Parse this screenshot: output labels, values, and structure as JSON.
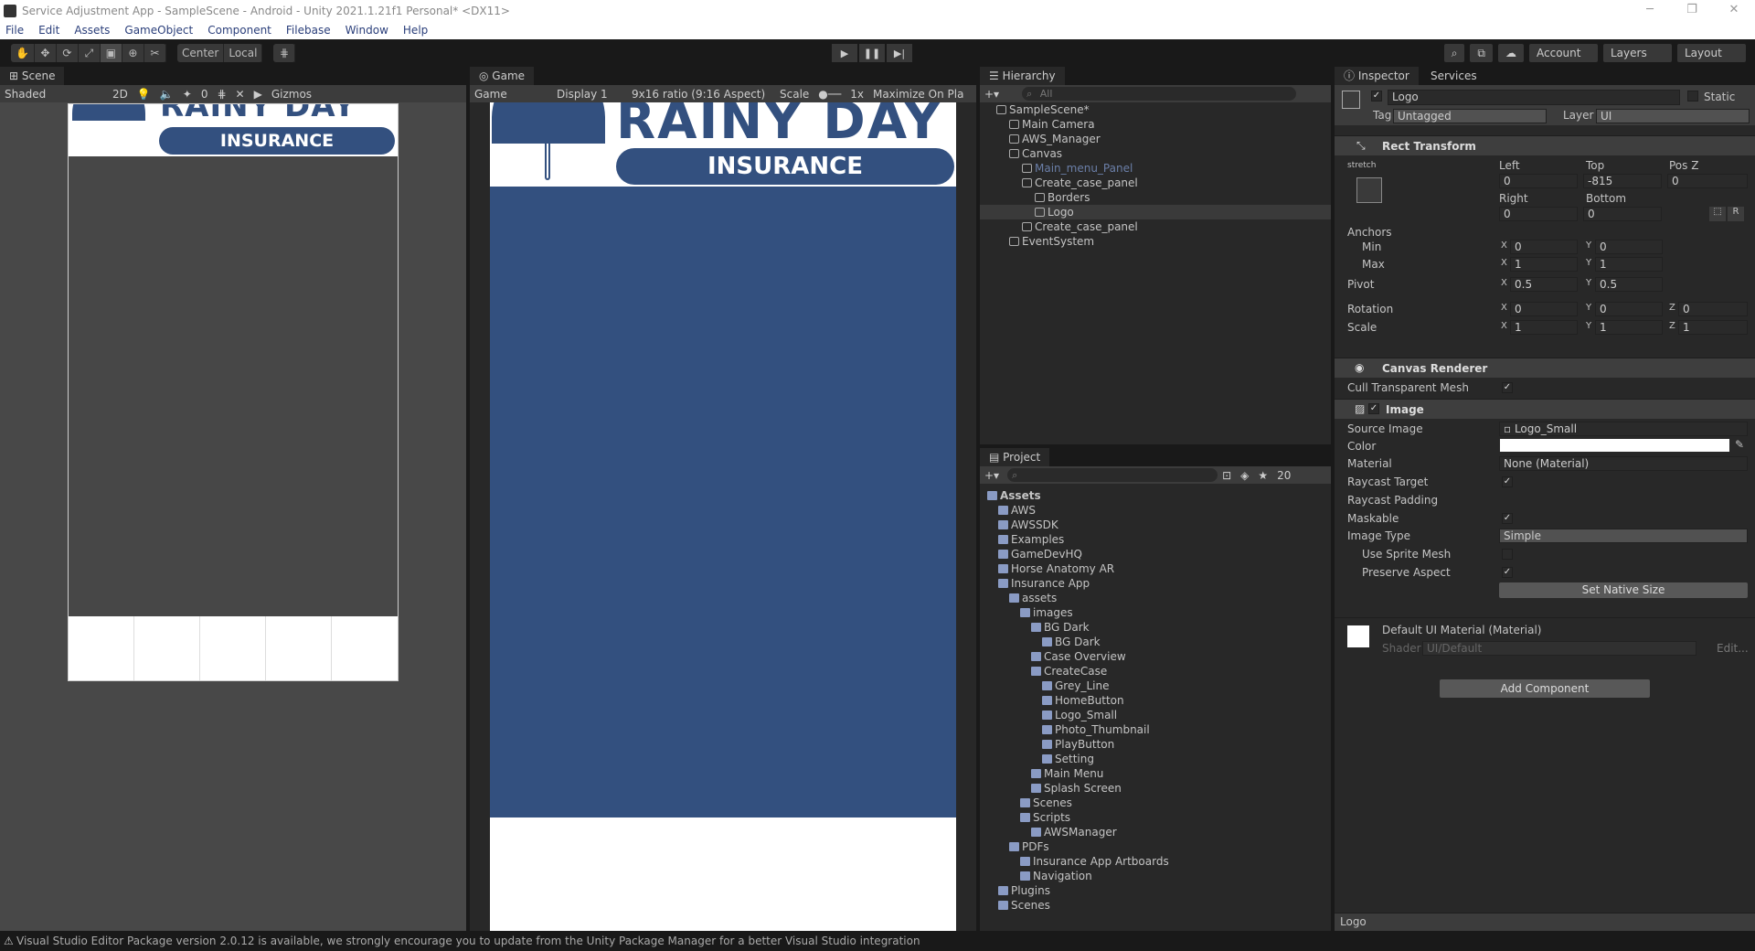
{
  "window": {
    "title": "Service Adjustment App - SampleScene - Android - Unity 2021.1.21f1 Personal* <DX11>",
    "min": "─",
    "max": "❐",
    "close": "✕"
  },
  "menu": [
    "File",
    "Edit",
    "Assets",
    "GameObject",
    "Component",
    "Filebase",
    "Window",
    "Help"
  ],
  "toolbar": {
    "center": "Center",
    "local": "Local",
    "account": "Account",
    "layers": "Layers",
    "layout": "Layout"
  },
  "scene": {
    "tab": "Scene",
    "shading": "Shaded",
    "mode2d": "2D",
    "gizmos": "Gizmos",
    "count": "0",
    "banner_top": "RAINY DAY",
    "banner_sub": "INSURANCE"
  },
  "game": {
    "tab": "Game",
    "display": "Game",
    "display_num": "Display 1",
    "ratio": "9x16 ratio (9:16 Aspect)",
    "scale_label": "Scale",
    "scale_value": "1x",
    "maximize": "Maximize On Pla",
    "banner_top": "RAINY DAY",
    "banner_sub": "INSURANCE"
  },
  "hierarchy": {
    "tab": "Hierarchy",
    "search_placeholder": "All",
    "items": [
      {
        "label": "SampleScene*",
        "indent": 0,
        "kind": "scene"
      },
      {
        "label": "Main Camera",
        "indent": 1,
        "kind": "go"
      },
      {
        "label": "AWS_Manager",
        "indent": 1,
        "kind": "go"
      },
      {
        "label": "Canvas",
        "indent": 1,
        "kind": "go"
      },
      {
        "label": "Main_menu_Panel",
        "indent": 2,
        "kind": "dim"
      },
      {
        "label": "Create_case_panel",
        "indent": 2,
        "kind": "go"
      },
      {
        "label": "Borders",
        "indent": 3,
        "kind": "go"
      },
      {
        "label": "Logo",
        "indent": 3,
        "kind": "sel"
      },
      {
        "label": "Create_case_panel",
        "indent": 2,
        "kind": "go"
      },
      {
        "label": "EventSystem",
        "indent": 1,
        "kind": "go"
      }
    ]
  },
  "project": {
    "tab": "Project",
    "hidden_count": "20",
    "items": [
      {
        "label": "Assets",
        "indent": 0,
        "bold": true
      },
      {
        "label": "AWS",
        "indent": 1
      },
      {
        "label": "AWSSDK",
        "indent": 1
      },
      {
        "label": "Examples",
        "indent": 1
      },
      {
        "label": "GameDevHQ",
        "indent": 1
      },
      {
        "label": "Horse Anatomy AR",
        "indent": 1
      },
      {
        "label": "Insurance App",
        "indent": 1
      },
      {
        "label": "assets",
        "indent": 2
      },
      {
        "label": "images",
        "indent": 3
      },
      {
        "label": "BG Dark",
        "indent": 4
      },
      {
        "label": "BG Dark",
        "indent": 5
      },
      {
        "label": "Case Overview",
        "indent": 4
      },
      {
        "label": "CreateCase",
        "indent": 4
      },
      {
        "label": "Grey_Line",
        "indent": 5
      },
      {
        "label": "HomeButton",
        "indent": 5
      },
      {
        "label": "Logo_Small",
        "indent": 5
      },
      {
        "label": "Photo_Thumbnail",
        "indent": 5
      },
      {
        "label": "PlayButton",
        "indent": 5
      },
      {
        "label": "Setting",
        "indent": 5
      },
      {
        "label": "Main Menu",
        "indent": 4
      },
      {
        "label": "Splash Screen",
        "indent": 4
      },
      {
        "label": "Scenes",
        "indent": 3
      },
      {
        "label": "Scripts",
        "indent": 3
      },
      {
        "label": "AWSManager",
        "indent": 4
      },
      {
        "label": "PDFs",
        "indent": 2
      },
      {
        "label": "Insurance App Artboards",
        "indent": 3
      },
      {
        "label": "Navigation",
        "indent": 3
      },
      {
        "label": "Plugins",
        "indent": 1
      },
      {
        "label": "Scenes",
        "indent": 1
      }
    ]
  },
  "inspector": {
    "tab": "Inspector",
    "tab2": "Services",
    "name": "Logo",
    "static": "Static",
    "tag_label": "Tag",
    "tag": "Untagged",
    "layer_label": "Layer",
    "layer": "UI",
    "rect": {
      "title": "Rect Transform",
      "stretch": "stretch",
      "left_lbl": "Left",
      "top_lbl": "Top",
      "posz_lbl": "Pos Z",
      "left": "0",
      "top": "-815",
      "posz": "0",
      "right_lbl": "Right",
      "bottom_lbl": "Bottom",
      "right": "0",
      "bottom": "0",
      "r": "R",
      "anchors": "Anchors",
      "min": "Min",
      "max": "Max",
      "min_x": "0",
      "min_y": "0",
      "max_x": "1",
      "max_y": "1",
      "pivot": "Pivot",
      "pivot_x": "0.5",
      "pivot_y": "0.5",
      "rotation": "Rotation",
      "rot_x": "0",
      "rot_y": "0",
      "rot_z": "0",
      "scale": "Scale",
      "sc_x": "1",
      "sc_y": "1",
      "sc_z": "1",
      "x": "X",
      "y": "Y",
      "z": "Z"
    },
    "canvas_renderer": {
      "title": "Canvas Renderer",
      "cull": "Cull Transparent Mesh"
    },
    "image": {
      "title": "Image",
      "source_lbl": "Source Image",
      "source": "Logo_Small",
      "color_lbl": "Color",
      "material_lbl": "Material",
      "material": "None (Material)",
      "raycast": "Raycast Target",
      "raycast_pad": "Raycast Padding",
      "maskable": "Maskable",
      "type_lbl": "Image Type",
      "type": "Simple",
      "sprite_mesh": "Use Sprite Mesh",
      "preserve": "Preserve Aspect",
      "native": "Set Native Size"
    },
    "material": {
      "title": "Default UI Material (Material)",
      "shader_lbl": "Shader",
      "shader": "UI/Default",
      "edit": "Edit..."
    },
    "add_component": "Add Component",
    "footer": "Logo"
  },
  "status": "Visual Studio Editor Package version 2.0.12 is available, we strongly encourage you to update from the Unity Package Manager for a better Visual Studio integration",
  "colors": {
    "brand_blue": "#33507f",
    "bg_dark": "#282828"
  }
}
